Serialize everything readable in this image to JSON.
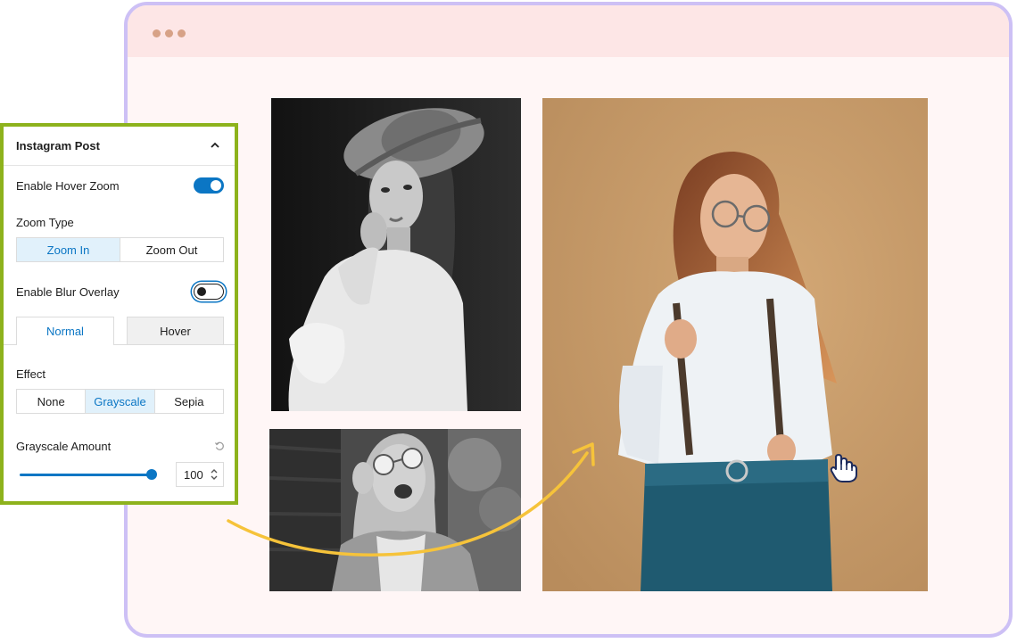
{
  "browser": {
    "dots": 3,
    "frame_color": "#cdc0f5",
    "bar_color": "#fde6e6"
  },
  "panel": {
    "title": "Instagram Post",
    "hover_zoom_label": "Enable Hover Zoom",
    "hover_zoom_enabled": true,
    "zoom_type_label": "Zoom Type",
    "zoom_type_options": [
      "Zoom In",
      "Zoom Out"
    ],
    "zoom_type_selected": "Zoom In",
    "blur_overlay_label": "Enable Blur Overlay",
    "blur_overlay_enabled": false,
    "tabs": [
      "Normal",
      "Hover"
    ],
    "tab_selected": "Normal",
    "effect_label": "Effect",
    "effect_options": [
      "None",
      "Grayscale",
      "Sepia"
    ],
    "effect_selected": "Grayscale",
    "grayscale_label": "Grayscale Amount",
    "grayscale_value": "100",
    "grayscale_fraction": 1.0
  },
  "photos": [
    {
      "name": "woman-in-hat-bw",
      "style": "grayscale"
    },
    {
      "name": "laughing-woman-sunglasses-bw",
      "style": "grayscale"
    },
    {
      "name": "woman-with-glasses-color",
      "style": "color"
    }
  ],
  "colors": {
    "accent": "#0b76c4",
    "panel_border": "#8db21c",
    "arrow": "#f6c33a"
  }
}
